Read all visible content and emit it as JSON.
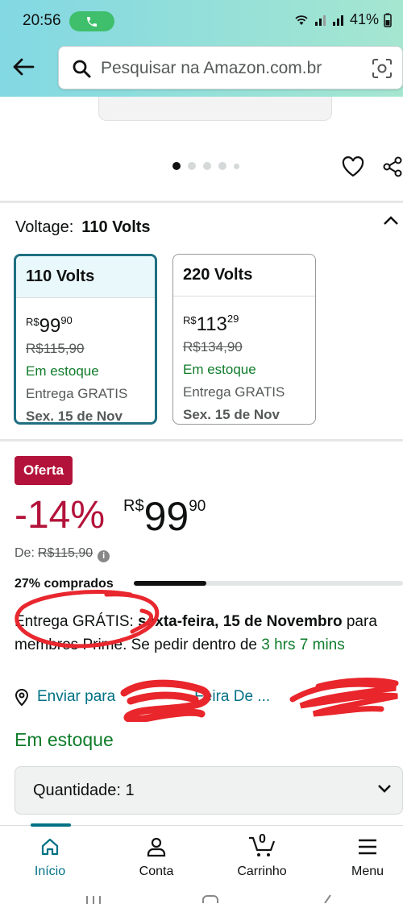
{
  "status_bar": {
    "time": "20:56",
    "battery": "41%"
  },
  "search": {
    "placeholder": "Pesquisar na Amazon.com.br"
  },
  "carousel": {
    "count": 5,
    "active": 0
  },
  "voltage": {
    "label": "Voltage:",
    "selected": "110 Volts",
    "options": [
      {
        "name": "110 Volts",
        "currency": "R$",
        "price_int": "99",
        "price_cents": "90",
        "list_price": "R$115,90",
        "stock": "Em estoque",
        "shipping": "Entrega GRATIS",
        "date": "Sex. 15 de Nov"
      },
      {
        "name": "220 Volts",
        "currency": "R$",
        "price_int": "113",
        "price_cents": "29",
        "list_price": "R$134,90",
        "stock": "Em estoque",
        "shipping": "Entrega GRATIS",
        "date": "Sex. 15 de Nov"
      }
    ]
  },
  "deal": {
    "badge": "Oferta",
    "discount": "-14%",
    "currency": "R$",
    "price_int": "99",
    "price_cents": "90",
    "list_label": "De:",
    "list_price": "R$115,90",
    "bought_text": "27% comprados",
    "bought_fraction": 0.27
  },
  "delivery": {
    "prefix": "Entrega GRÁTIS:",
    "date": "sexta-feira, 15 de Novembro",
    "middle": "para membros Prime. Se pedir dentro de",
    "countdown": "3 hrs 7 mins"
  },
  "shipping": {
    "prefix": "Enviar para",
    "location": "Feira De ..."
  },
  "stock": "Em estoque",
  "quantity": {
    "label": "Quantidade:",
    "value": "1"
  },
  "cart_count": "0",
  "nav": [
    {
      "label": "Início"
    },
    {
      "label": "Conta"
    },
    {
      "label": "Carrinho"
    },
    {
      "label": "Menu"
    }
  ]
}
